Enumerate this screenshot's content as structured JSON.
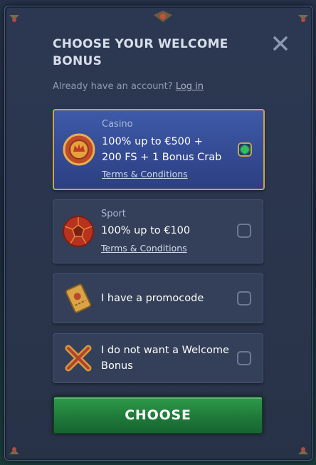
{
  "modal": {
    "title": "CHOOSE YOUR WELCOME BONUS",
    "account_prompt": "Already have an account?",
    "login_link": "Log in"
  },
  "options": [
    {
      "category": "Casino",
      "line1": "100% up to €500 +",
      "line2": "200 FS + 1 Bonus Crab",
      "terms": "Terms & Conditions",
      "icon": "casino-chip-icon",
      "selected": true
    },
    {
      "category": "Sport",
      "line1": "100% up to €100",
      "terms": "Terms & Conditions",
      "icon": "soccer-ball-icon",
      "selected": false
    },
    {
      "line1": "I have a promocode",
      "icon": "ticket-icon",
      "selected": false
    },
    {
      "line1": "I do not want a Welcome",
      "line2": "Bonus",
      "icon": "cross-icon",
      "selected": false
    }
  ],
  "choose_button": "CHOOSE",
  "colors": {
    "accent_gold": "#c9a54b",
    "selected_card": "#34479a",
    "choose_green": "#237f3e"
  }
}
